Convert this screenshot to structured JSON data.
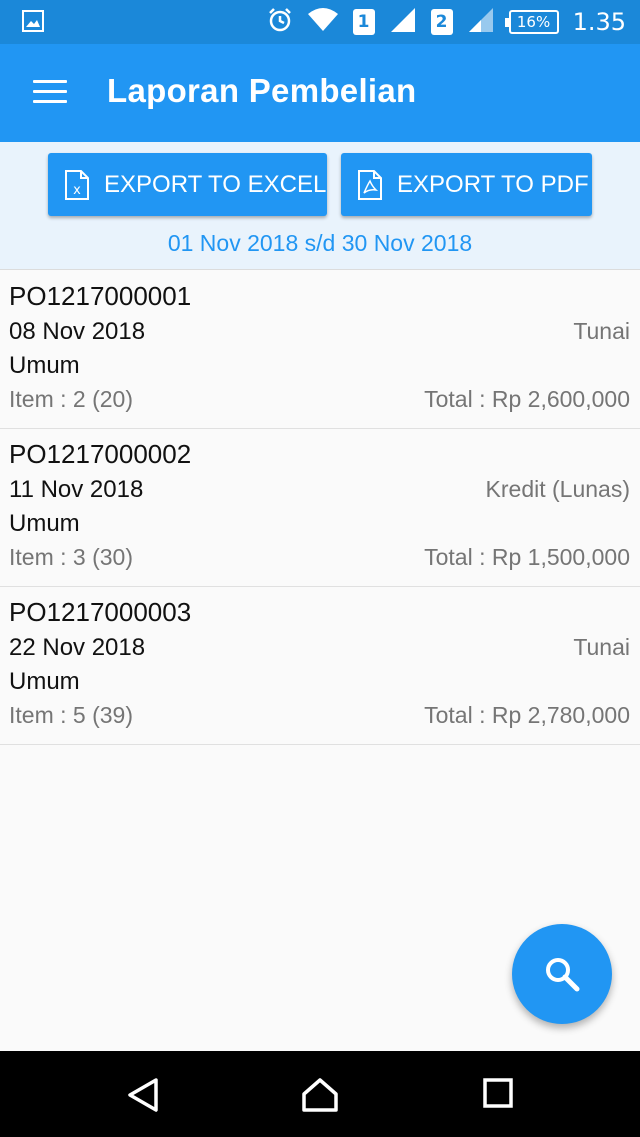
{
  "status_bar": {
    "sim1": "1",
    "sim2": "2",
    "battery": "16%",
    "time": "1.35",
    "icons": [
      "image-icon",
      "alarm-icon",
      "wifi-icon",
      "signal-icon",
      "battery-icon"
    ]
  },
  "app_bar": {
    "title": "Laporan Pembelian",
    "menu_icon": "menu-icon"
  },
  "export": {
    "excel_label": "EXPORT TO EXCEL",
    "pdf_label": "EXPORT TO PDF",
    "date_range": "01 Nov 2018 s/d 30 Nov 2018"
  },
  "purchases": [
    {
      "po": "PO1217000001",
      "date": "08 Nov 2018",
      "party": "Umum",
      "payment": "Tunai",
      "items": "Item : 2 (20)",
      "total": "Total : Rp 2,600,000"
    },
    {
      "po": "PO1217000002",
      "date": "11 Nov 2018",
      "party": "Umum",
      "payment": "Kredit (Lunas)",
      "items": "Item : 3 (30)",
      "total": "Total : Rp 1,500,000"
    },
    {
      "po": "PO1217000003",
      "date": "22 Nov 2018",
      "party": "Umum",
      "payment": "Tunai",
      "items": "Item : 5 (39)",
      "total": "Total : Rp 2,780,000"
    }
  ],
  "fab": {
    "icon": "search-icon"
  },
  "nav_bar": {
    "icons": [
      "back-icon",
      "home-icon",
      "recents-icon"
    ]
  },
  "colors": {
    "primary": "#2196f3",
    "status_bar": "#1b88d9",
    "export_bg": "#e9f3fc",
    "secondary_text": "#757575"
  }
}
